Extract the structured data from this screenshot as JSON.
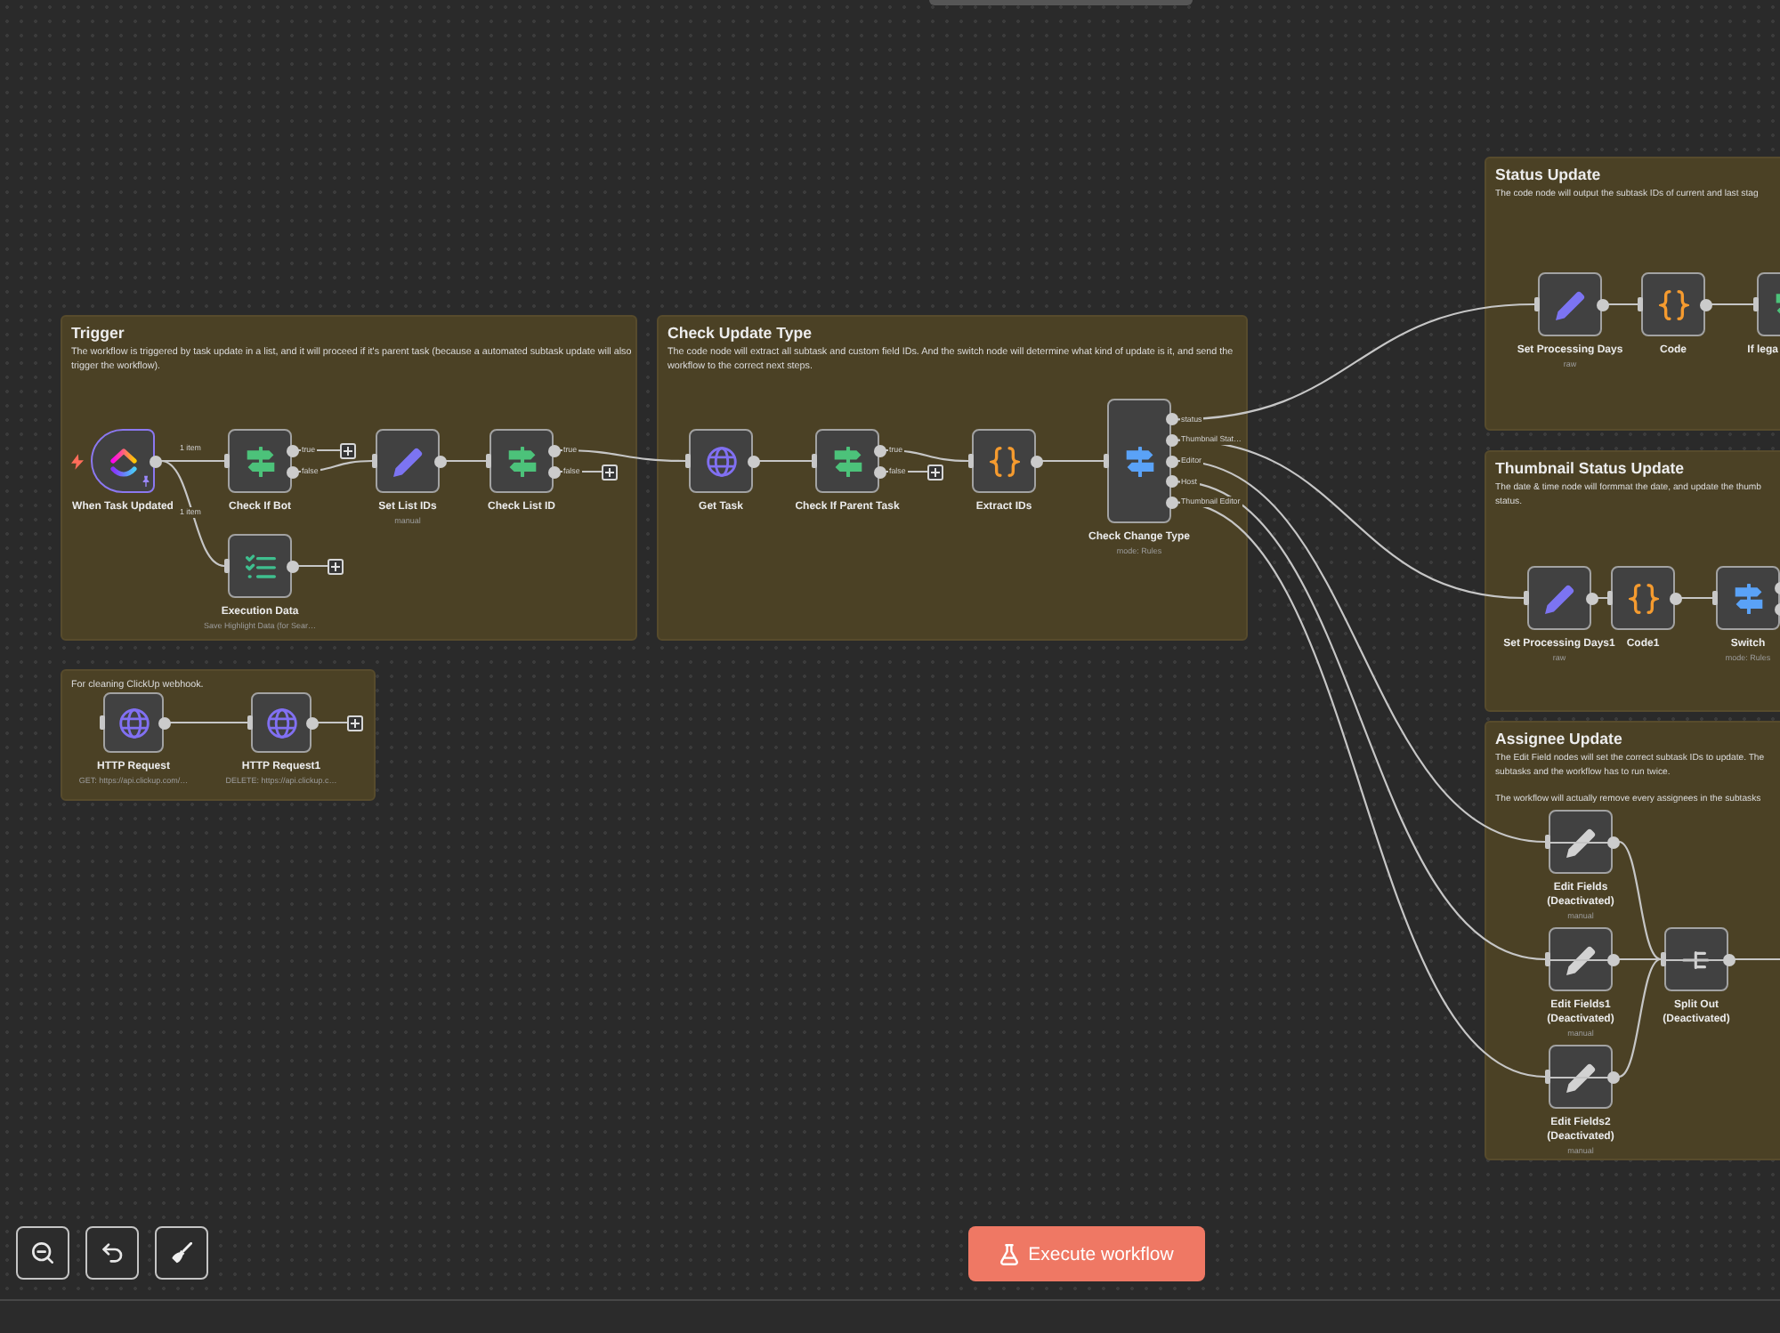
{
  "groups": [
    {
      "title": "Trigger",
      "description": "The workflow is triggered by task update in a list, and it will proceed if it's parent task (because a automated subtask update will also trigger the workflow).",
      "nodes": [
        {
          "name": "When Task Updated",
          "kind": "trigger",
          "deactivated": false,
          "pinned": true,
          "edge_labels": [
            "1 item",
            "1 item"
          ]
        },
        {
          "name": "Check If Bot",
          "kind": "if",
          "deactivated": false,
          "pinned": false,
          "outputs": [
            "true",
            "false"
          ]
        },
        {
          "name": "Set List IDs",
          "kind": "set",
          "subtitle": "manual",
          "deactivated": false,
          "pinned": false
        },
        {
          "name": "Check List ID",
          "kind": "if",
          "deactivated": false,
          "pinned": false,
          "outputs": [
            "true",
            "false"
          ]
        },
        {
          "name": "Execution Data",
          "kind": "execution-data",
          "subtitle": "Save Highlight Data (for Sear…",
          "deactivated": false,
          "pinned": false
        }
      ]
    },
    {
      "title": "Check Update Type",
      "description": "The code node will extract all subtask and custom field IDs. And the switch node will determine what kind of update is it, and send the workflow to the correct next steps.",
      "nodes": [
        {
          "name": "Get Task",
          "kind": "http",
          "deactivated": false,
          "pinned": false
        },
        {
          "name": "Check If Parent Task",
          "kind": "if",
          "deactivated": false,
          "pinned": false,
          "outputs": [
            "true",
            "false"
          ]
        },
        {
          "name": "Extract IDs",
          "kind": "code",
          "deactivated": false,
          "pinned": false
        },
        {
          "name": "Check Change Type",
          "kind": "switch",
          "subtitle": "mode: Rules",
          "deactivated": false,
          "pinned": false,
          "outputs": [
            "status",
            "Thumbnail Stat…",
            "Editor",
            "Host",
            "Thumbnail Editor"
          ]
        }
      ]
    },
    {
      "description": "For cleaning ClickUp webhook.",
      "nodes": [
        {
          "name": "HTTP Request",
          "kind": "http",
          "subtitle": "GET: https://api.clickup.com/…",
          "deactivated": false,
          "pinned": false
        },
        {
          "name": "HTTP Request1",
          "kind": "http",
          "subtitle": "DELETE: https://api.clickup.c…",
          "deactivated": false,
          "pinned": false
        }
      ]
    },
    {
      "title": "Status Update",
      "description": "The code node will output the subtask IDs of current and last stag",
      "nodes": [
        {
          "name": "Set Processing Days",
          "kind": "set",
          "subtitle": "raw",
          "deactivated": false,
          "pinned": false
        },
        {
          "name": "Code",
          "kind": "code",
          "deactivated": false,
          "pinned": false
        },
        {
          "name": "If lega",
          "kind": "if",
          "deactivated": false,
          "pinned": false
        }
      ]
    },
    {
      "title": "Thumbnail Status Update",
      "description": "The date & time node will formmat the date, and update the thumb\nstatus.",
      "nodes": [
        {
          "name": "Set Processing Days1",
          "kind": "set",
          "subtitle": "raw",
          "deactivated": false,
          "pinned": false
        },
        {
          "name": "Code1",
          "kind": "code",
          "deactivated": false,
          "pinned": false
        },
        {
          "name": "Switch",
          "kind": "switch",
          "subtitle": "mode: Rules",
          "deactivated": false,
          "pinned": false
        }
      ]
    },
    {
      "title": "Assignee Update",
      "description": "The Edit Field nodes will set the correct subtask IDs to update. The\nsubtasks and the workflow has to run twice.\n\nThe workflow will actually remove every assignees in the subtasks",
      "nodes": [
        {
          "name": "Edit Fields",
          "status_text": "(Deactivated)",
          "kind": "set",
          "subtitle": "manual",
          "deactivated": true,
          "pinned": false
        },
        {
          "name": "Edit Fields1",
          "status_text": "(Deactivated)",
          "kind": "set",
          "subtitle": "manual",
          "deactivated": true,
          "pinned": false
        },
        {
          "name": "Edit Fields2",
          "status_text": "(Deactivated)",
          "kind": "set",
          "subtitle": "manual",
          "deactivated": true,
          "pinned": false
        },
        {
          "name": "Split Out",
          "status_text": "(Deactivated)",
          "kind": "split-out",
          "deactivated": true,
          "pinned": false
        }
      ]
    }
  ],
  "execute_button": {
    "label": "Execute workflow"
  }
}
